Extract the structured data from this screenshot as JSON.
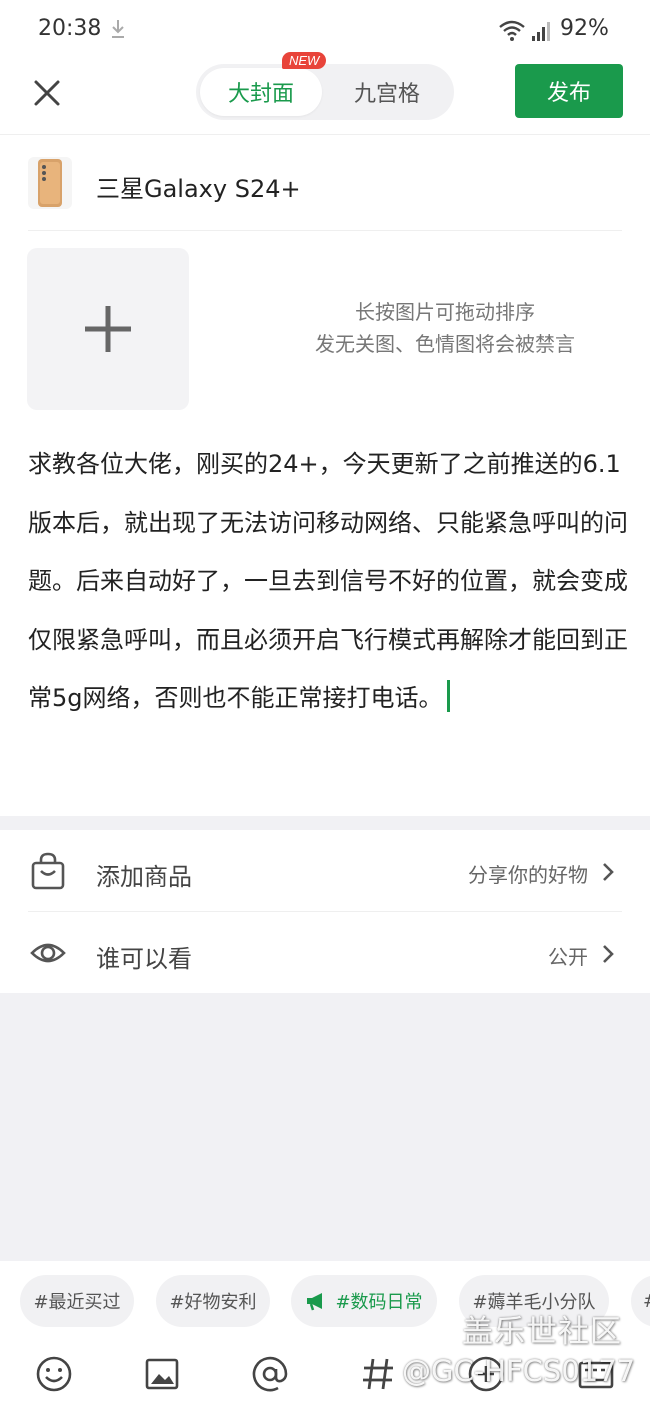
{
  "status_bar": {
    "time": "20:38",
    "battery": "92%"
  },
  "top_bar": {
    "tabs": [
      {
        "label": "大封面",
        "active": true
      },
      {
        "label": "九宫格",
        "active": false
      }
    ],
    "new_badge": "NEW",
    "publish_label": "发布"
  },
  "product": {
    "name": "三星Galaxy S24+"
  },
  "image_area": {
    "hint_line1": "长按图片可拖动排序",
    "hint_line2": "发无关图、色情图将会被禁言"
  },
  "post": {
    "text": "求教各位大佬，刚买的24+，今天更新了之前推送的6.1版本后，就出现了无法访问移动网络、只能紧急呼叫的问题。后来自动好了，一旦去到信号不好的位置，就会变成仅限紧急呼叫，而且必须开启飞行模式再解除才能回到正常5g网络，否则也不能正常接打电话。"
  },
  "options": {
    "add_product_label": "添加商品",
    "add_product_value": "分享你的好物",
    "visibility_label": "谁可以看",
    "visibility_value": "公开"
  },
  "tags": [
    {
      "label": "#最近买过"
    },
    {
      "label": "#好物安利"
    },
    {
      "label": "#数码日常",
      "highlight": true
    },
    {
      "label": "#薅羊毛小分队"
    },
    {
      "label": "#"
    }
  ],
  "watermark": {
    "line1": "盖乐世社区",
    "line2": "@GC-HFCS0177"
  },
  "colors": {
    "accent": "#1a9a4c",
    "badge": "#e8443a",
    "background_gray": "#f1f1f4"
  }
}
